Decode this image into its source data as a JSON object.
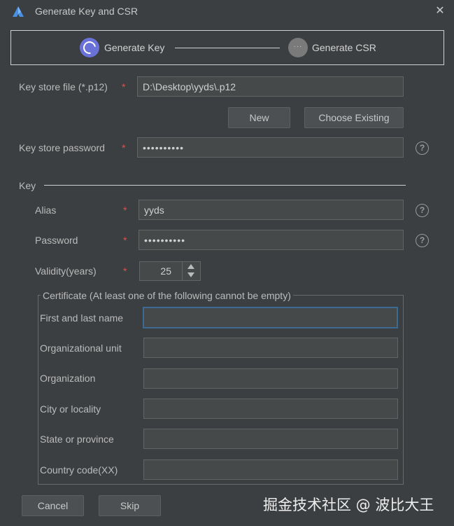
{
  "window": {
    "title": "Generate Key and CSR",
    "close_label": "✕"
  },
  "steps": [
    {
      "label": "Generate Key",
      "active": true
    },
    {
      "label": "Generate CSR",
      "active": false,
      "icon_text": "···"
    }
  ],
  "keystore": {
    "file_label": "Key store file (*.p12)",
    "file_value": "D:\\Desktop\\yyds\\.p12",
    "new_label": "New",
    "choose_label": "Choose Existing",
    "password_label": "Key store password",
    "password_value": "••••••••••"
  },
  "key": {
    "section_label": "Key",
    "alias_label": "Alias",
    "alias_value": "yyds",
    "password_label": "Password",
    "password_value": "••••••••••",
    "validity_label": "Validity(years)",
    "validity_value": "25"
  },
  "certificate": {
    "title": "Certificate (At least one of the following cannot be empty)",
    "fields": [
      {
        "label": "First and last name",
        "value": ""
      },
      {
        "label": "Organizational unit",
        "value": ""
      },
      {
        "label": "Organization",
        "value": ""
      },
      {
        "label": "City or locality",
        "value": ""
      },
      {
        "label": "State or province",
        "value": ""
      },
      {
        "label": "Country code(XX)",
        "value": ""
      }
    ]
  },
  "footer": {
    "cancel_label": "Cancel",
    "skip_label": "Skip"
  },
  "required_mark": "*",
  "help_mark": "?",
  "watermark": "掘金技术社区 @ 波比大王",
  "colors": {
    "background": "#3c3f41",
    "field_bg": "#45494a",
    "accent": "#6a72d8",
    "required": "#d9534f",
    "focus": "#3d6a93"
  }
}
